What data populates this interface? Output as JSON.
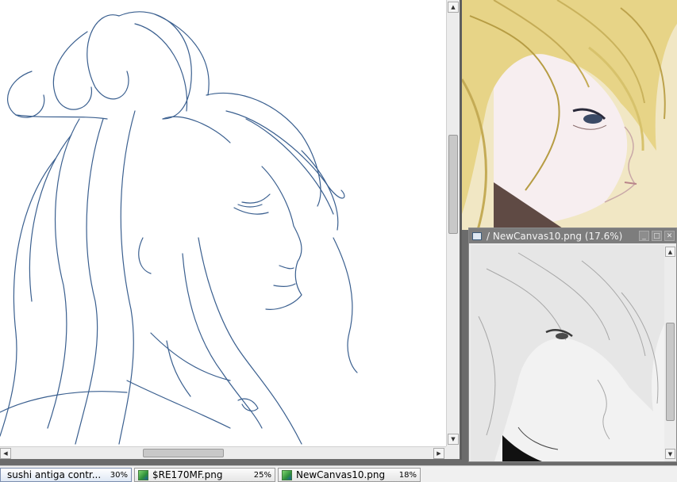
{
  "sub_window": {
    "title": "/ NewCanvas10.png (17.6%)"
  },
  "taskbar": {
    "items": [
      {
        "label": "sushi antiga contr...",
        "zoom": "30%"
      },
      {
        "label": "$RE170MF.png",
        "zoom": "25%"
      },
      {
        "label": "NewCanvas10.png",
        "zoom": "18%"
      }
    ]
  },
  "icons": {
    "window_icon": "canvas-window-icon",
    "minimize": "minimize-icon",
    "maximize": "maximize-icon",
    "close": "close-icon",
    "task_icon": "image-file-icon"
  },
  "colors": {
    "sketch_line": "#3a5f8f",
    "hair_blonde": "#e7d487",
    "skin": "#f7eef0"
  }
}
